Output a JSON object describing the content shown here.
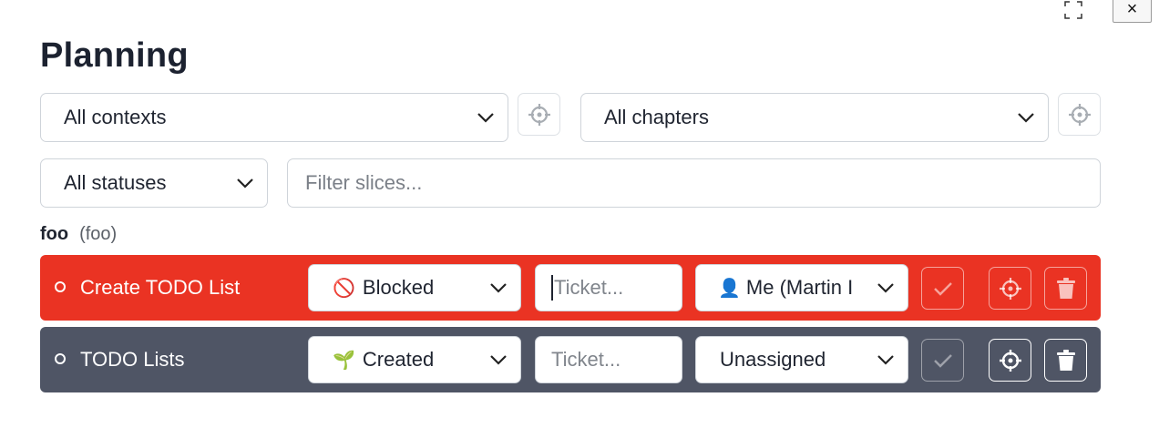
{
  "window": {
    "fullscreen_icon": "fullscreen-icon",
    "close_label": "×"
  },
  "page": {
    "title": "Planning"
  },
  "filters": {
    "context_select": "All contexts",
    "chapter_select": "All chapters",
    "status_select": "All statuses",
    "slice_filter_placeholder": "Filter slices..."
  },
  "group": {
    "name": "foo",
    "detail": "(foo)"
  },
  "slices": [
    {
      "name": "Create TODO List",
      "status_emoji": "🚫",
      "status": "Blocked",
      "ticket_placeholder": "Ticket...",
      "assignee_emoji": "👤",
      "assignee": "Me (Martin I",
      "row_color": "#ea3323"
    },
    {
      "name": "TODO Lists",
      "status_emoji": "🌱",
      "status": "Created",
      "ticket_placeholder": "Ticket...",
      "assignee_emoji": "",
      "assignee": "Unassigned",
      "row_color": "#4f5565"
    }
  ]
}
